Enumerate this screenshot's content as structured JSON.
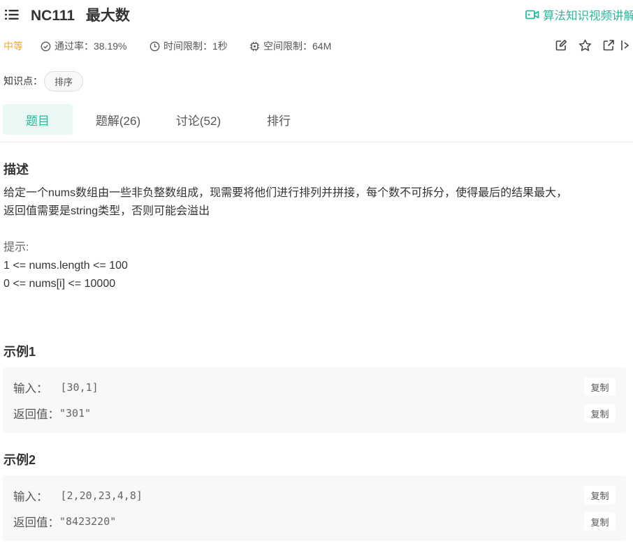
{
  "header": {
    "problem_id": "NC111",
    "problem_title": "最大数",
    "video_link": "算法知识视频讲解"
  },
  "meta": {
    "difficulty": "中等",
    "pass_rate": "通过率：38.19%",
    "time_limit": "时间限制：1秒",
    "space_limit": "空间限制：64M"
  },
  "knowledge": {
    "label": "知识点：",
    "tags": [
      "排序"
    ]
  },
  "tabs": [
    {
      "label": "题目",
      "active": true
    },
    {
      "label": "题解(26)",
      "active": false
    },
    {
      "label": "讨论(52)",
      "active": false
    },
    {
      "label": "排行",
      "active": false
    }
  ],
  "description": {
    "heading": "描述",
    "line1": "给定一个nums数组由一些非负整数组成，现需要将他们进行排列并拼接，每个数不可拆分，使得最后的结果最大，",
    "line2": "返回值需要是string类型，否则可能会溢出",
    "hint_label": "提示:",
    "hint1": "1 <= nums.length <= 100",
    "hint2": "0 <= nums[i] <= 10000"
  },
  "examples": [
    {
      "heading": "示例1",
      "input_label": "输入：",
      "input_value": "[30,1]",
      "output_label": "返回值：",
      "output_value": "\"301\"",
      "copy_label": "复制"
    },
    {
      "heading": "示例2",
      "input_label": "输入：",
      "input_value": "[2,20,23,4,8]",
      "output_label": "返回值：",
      "output_value": "\"8423220\"",
      "copy_label": "复制"
    }
  ],
  "colors": {
    "accent": "#25bb9b",
    "difficulty_medium": "#f5a623"
  }
}
